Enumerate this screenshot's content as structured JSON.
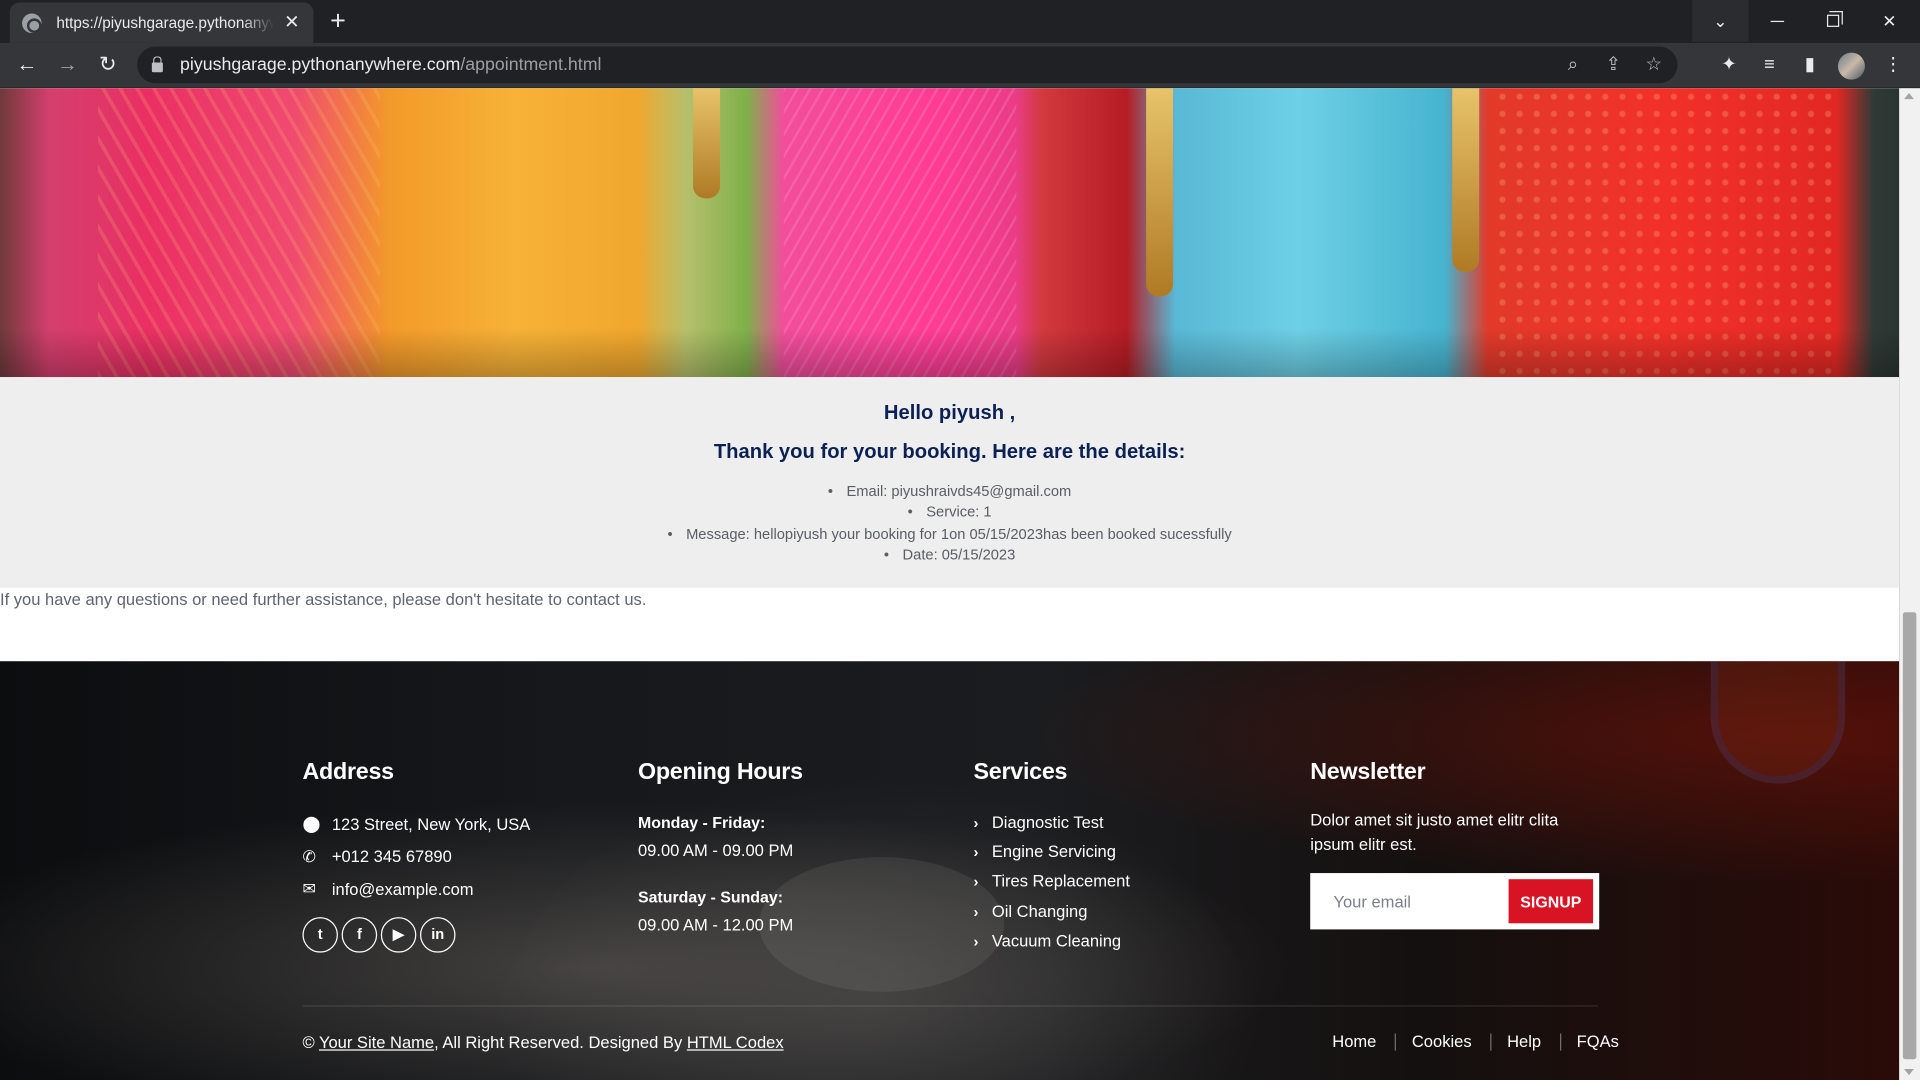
{
  "browser": {
    "tab_title": "https://piyushgarage.pythonanywhere.com/appointment.html",
    "url_host": "piyushgarage.pythonanywhere.com",
    "url_path": "/appointment.html"
  },
  "booking": {
    "greeting": "Hello piyush ,",
    "thanks": "Thank you for your booking. Here are the details:",
    "details": [
      "Email: piyushraivds45@gmail.com",
      "Service: 1",
      "Message: hellopiyush your booking for 1on 05/15/2023has been booked sucessfully",
      "Date: 05/15/2023"
    ],
    "help": "If you have any questions or need further assistance, please don't hesitate to contact us."
  },
  "footer": {
    "address": {
      "title": "Address",
      "street": "123 Street, New York, USA",
      "phone": "+012 345 67890",
      "email": "info@example.com",
      "socials": [
        "twitter-icon",
        "facebook-icon",
        "youtube-icon",
        "linkedin-icon"
      ]
    },
    "hours": {
      "title": "Opening Hours",
      "weekday_label": "Monday - Friday:",
      "weekday_time": "09.00 AM - 09.00 PM",
      "weekend_label": "Saturday - Sunday:",
      "weekend_time": "09.00 AM - 12.00 PM"
    },
    "services": {
      "title": "Services",
      "items": [
        "Diagnostic Test",
        "Engine Servicing",
        "Tires Replacement",
        "Oil Changing",
        "Vacuum Cleaning"
      ]
    },
    "newsletter": {
      "title": "Newsletter",
      "text": "Dolor amet sit justo amet elitr clita ipsum elitr est.",
      "placeholder": "Your email",
      "button": "SIGNUP"
    },
    "copyright": {
      "prefix": "©",
      "site_name": "Your Site Name",
      "middle": ", All Right Reserved. Designed By",
      "designer": "HTML Codex"
    },
    "links": [
      "Home",
      "Cookies",
      "Help",
      "FQAs"
    ]
  },
  "colors": {
    "heading_navy": "#0b2154",
    "signup_red": "#d81324",
    "details_bg": "#eeeeee"
  }
}
